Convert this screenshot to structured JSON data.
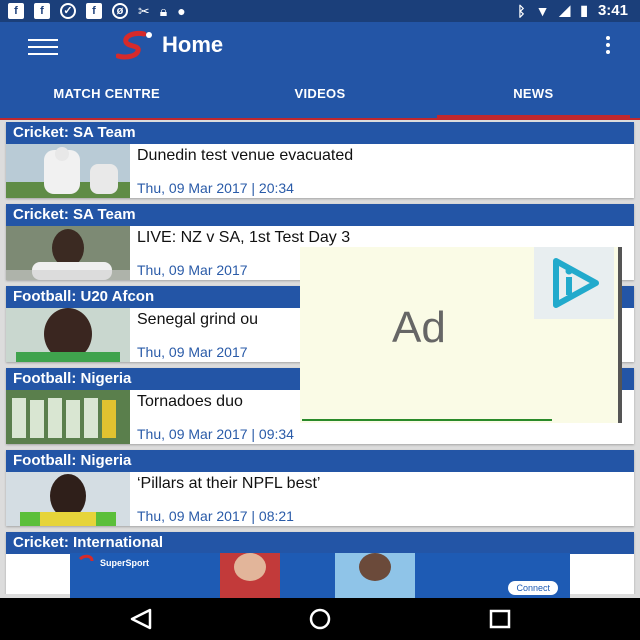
{
  "status_bar": {
    "time": "3:41"
  },
  "app_bar": {
    "title": "Home"
  },
  "tabs": [
    {
      "label": "MATCH CENTRE",
      "active": false
    },
    {
      "label": "VIDEOS",
      "active": false
    },
    {
      "label": "NEWS",
      "active": true
    }
  ],
  "news": [
    {
      "category": "Cricket: SA Team",
      "headline": "Dunedin test venue evacuated",
      "date": "Thu, 09 Mar 2017 | 20:34"
    },
    {
      "category": "Cricket: SA Team",
      "headline": "LIVE: NZ v SA, 1st Test Day 3",
      "date": "Thu, 09 Mar 2017"
    },
    {
      "category": "Football: U20 Afcon",
      "headline": "Senegal grind ou",
      "date": "Thu, 09 Mar 2017"
    },
    {
      "category": "Football: Nigeria",
      "headline": "Tornadoes duo",
      "date": "Thu, 09 Mar 2017 | 09:34"
    },
    {
      "category": "Football: Nigeria",
      "headline": "‘Pillars at their NPFL best’",
      "date": "Thu, 09 Mar 2017 | 08:21"
    },
    {
      "category": "Cricket: International",
      "headline": "",
      "date": ""
    }
  ],
  "ad": {
    "label": "Ad"
  },
  "banner": {
    "brand": "SuperSport",
    "button": "Connect"
  },
  "colors": {
    "status_bar": "#1b3f7a",
    "primary": "#2355a6",
    "accent": "#c0282d",
    "date_text": "#2a5ba8"
  }
}
